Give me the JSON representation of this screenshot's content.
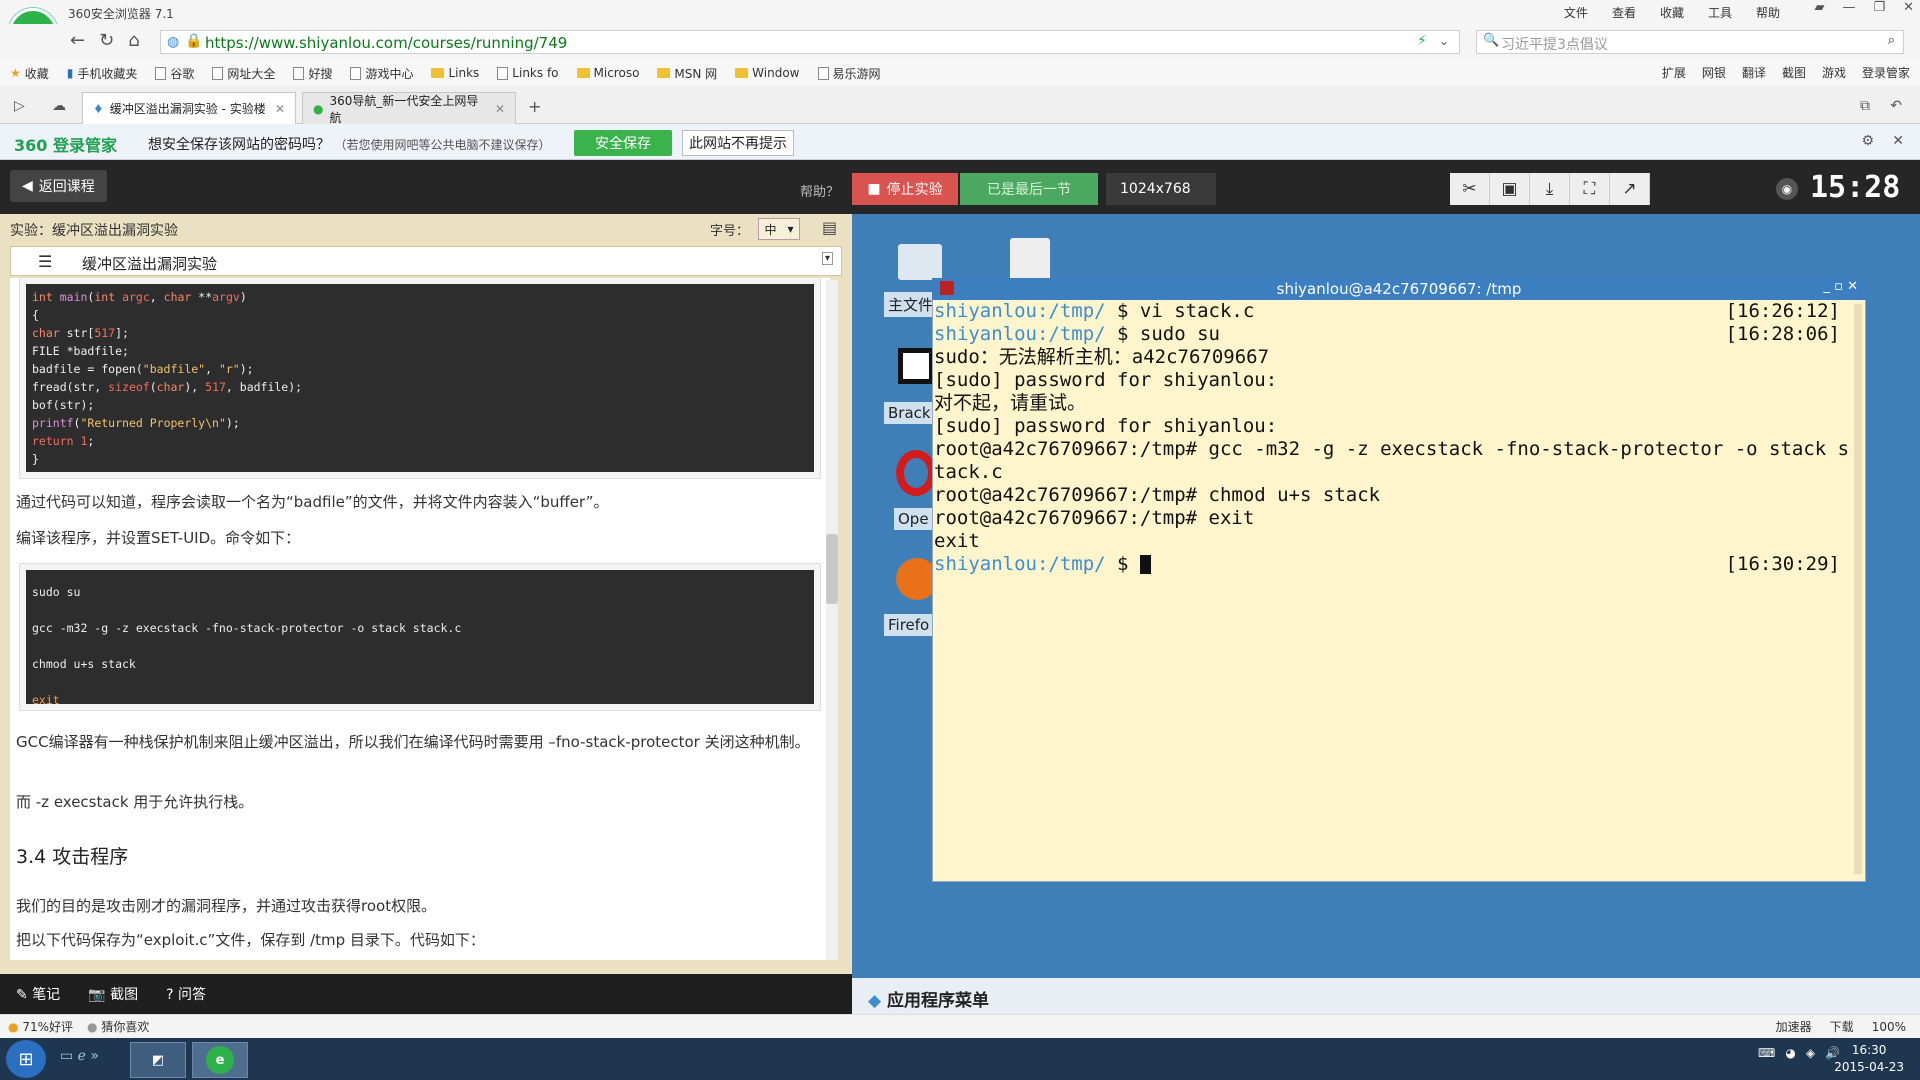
{
  "browser": {
    "title": "360安全浏览器 7.1",
    "menu": [
      "文件",
      "查看",
      "收藏",
      "工具",
      "帮助"
    ],
    "url": "https://www.shiyanlou.com/courses/running/749",
    "search_placeholder": "习近平提3点倡议",
    "bookmarks": [
      "收藏",
      "手机收藏夹",
      "谷歌",
      "网址大全",
      "好搜",
      "游戏中心",
      "Links",
      "Links fo",
      "Microso",
      "MSN 网",
      "Window",
      "易乐游网"
    ],
    "bookmarks_right": [
      "扩展",
      "网银",
      "翻译",
      "截图",
      "游戏",
      "登录管家"
    ],
    "tabs": [
      "缓冲区溢出漏洞实验 - 实验楼",
      "360导航_新一代安全上网导航"
    ]
  },
  "password_bar": {
    "brand": "360 登录管家",
    "message": "想安全保存该网站的密码吗？",
    "hint": "（若您使用网吧等公共电脑不建议保存）",
    "save": "安全保存",
    "never": "此网站不再提示"
  },
  "lab_toolbar": {
    "back": "返回课程",
    "help": "帮助？",
    "stop": "停止实验",
    "last": "已是最后一节",
    "resolution": "1024x768",
    "clock": "15:28"
  },
  "doc": {
    "header": "实验：缓冲区溢出漏洞实验",
    "font_label": "字号：",
    "font_value": "中",
    "toc_title": "缓冲区溢出漏洞实验",
    "para1": "通过代码可以知道，程序会读取一个名为“badfile”的文件，并将文件内容装入“buffer”。",
    "para2": "编译该程序，并设置SET-UID。命令如下：",
    "cmd1": "sudo su",
    "cmd2": "gcc -m32 -g -z execstack -fno-stack-protector -o stack stack.c",
    "cmd3": "chmod u+s stack",
    "cmd4": "exit",
    "para3": "GCC编译器有一种栈保护机制来阻止缓冲区溢出，所以我们在编译代码时需要用 –fno-stack-protector 关闭这种机制。",
    "para4": "而 -z execstack 用于允许执行栈。",
    "section": "3.4 攻击程序",
    "para5": "我们的目的是攻击刚才的漏洞程序，并通过攻击获得root权限。",
    "para6": "把以下代码保存为“exploit.c”文件，保存到 /tmp 目录下。代码如下："
  },
  "notes_bar": [
    "笔记",
    "截图",
    "问答"
  ],
  "desktop": {
    "icons": [
      "主文件",
      "Brack",
      "Ope",
      "Firefo"
    ],
    "app_menu": "应用程序菜单",
    "terminal_title": "shiyanlou@a42c76709667: /tmp",
    "terminal_lines": [
      {
        "prompt": "shiyanlou:/tmp/",
        "text": " $ vi stack.c",
        "ts": "[16:26:12]"
      },
      {
        "prompt": "shiyanlou:/tmp/",
        "text": " $ sudo su",
        "ts": "[16:28:06]"
      },
      {
        "prompt": "",
        "text": "sudo：无法解析主机：a42c76709667",
        "ts": ""
      },
      {
        "prompt": "",
        "text": "[sudo] password for shiyanlou:",
        "ts": ""
      },
      {
        "prompt": "",
        "text": "对不起，请重试。",
        "ts": ""
      },
      {
        "prompt": "",
        "text": "[sudo] password for shiyanlou:",
        "ts": ""
      },
      {
        "prompt": "",
        "text": "root@a42c76709667:/tmp# gcc -m32 -g -z execstack -fno-stack-protector -o stack s",
        "ts": ""
      },
      {
        "prompt": "",
        "text": "tack.c",
        "ts": ""
      },
      {
        "prompt": "",
        "text": "root@a42c76709667:/tmp# chmod u+s stack",
        "ts": ""
      },
      {
        "prompt": "",
        "text": "root@a42c76709667:/tmp# exit",
        "ts": ""
      },
      {
        "prompt": "",
        "text": "exit",
        "ts": ""
      },
      {
        "prompt": "shiyanlou:/tmp/",
        "text": " $ ",
        "ts": "[16:30:29]"
      }
    ]
  },
  "statusbar": {
    "left1": "71%好评",
    "left2": "猜你喜欢",
    "right": [
      "加速器",
      "下载",
      "100%"
    ]
  },
  "taskbar": {
    "time": "16:30",
    "date": "2015-04-23"
  }
}
